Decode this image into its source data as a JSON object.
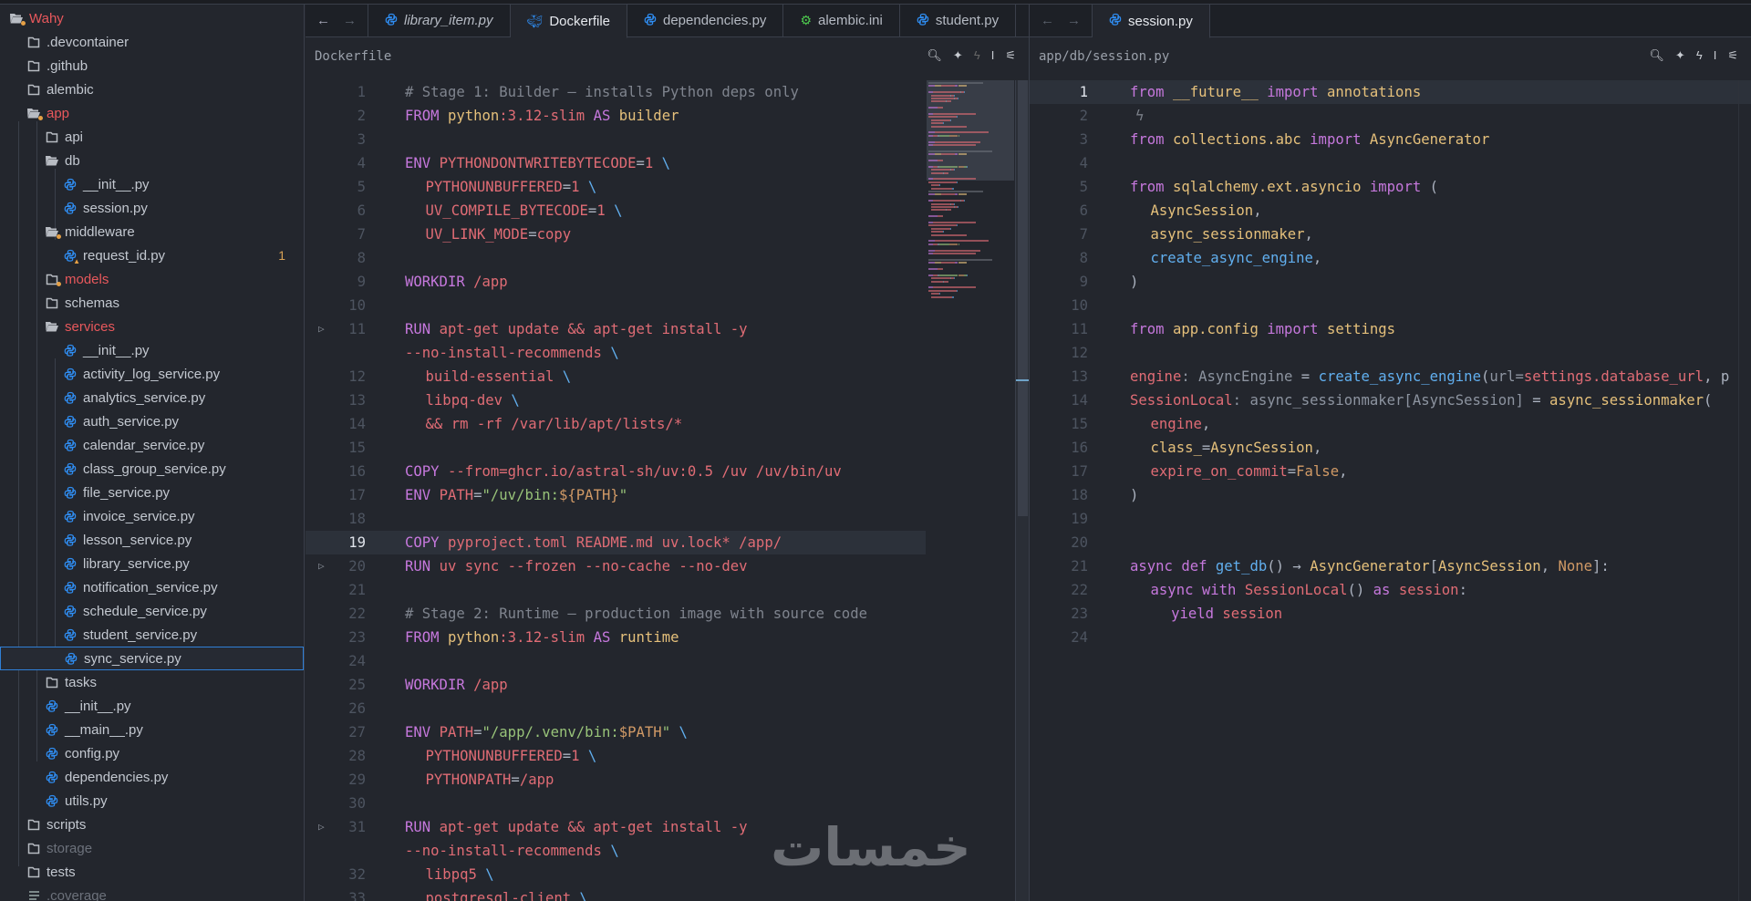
{
  "sidebar": {
    "items": [
      {
        "label": "Wahy",
        "level": 0,
        "icon": "folder-open-dot",
        "red": true
      },
      {
        "label": ".devcontainer",
        "level": 1,
        "icon": "folder"
      },
      {
        "label": ".github",
        "level": 1,
        "icon": "folder"
      },
      {
        "label": "alembic",
        "level": 1,
        "icon": "folder"
      },
      {
        "label": "app",
        "level": 1,
        "icon": "folder-open-dot",
        "red": true
      },
      {
        "label": "api",
        "level": 2,
        "icon": "folder"
      },
      {
        "label": "db",
        "level": 2,
        "icon": "folder-open"
      },
      {
        "label": "__init__.py",
        "level": 3,
        "icon": "python"
      },
      {
        "label": "session.py",
        "level": 3,
        "icon": "python"
      },
      {
        "label": "middleware",
        "level": 2,
        "icon": "folder-open-dot"
      },
      {
        "label": "request_id.py",
        "level": 3,
        "icon": "python-warning",
        "badge": "1"
      },
      {
        "label": "models",
        "level": 2,
        "icon": "folder-dot",
        "red": true
      },
      {
        "label": "schemas",
        "level": 2,
        "icon": "folder"
      },
      {
        "label": "services",
        "level": 2,
        "icon": "folder-open",
        "red": true
      },
      {
        "label": "__init__.py",
        "level": 3,
        "icon": "python"
      },
      {
        "label": "activity_log_service.py",
        "level": 3,
        "icon": "python"
      },
      {
        "label": "analytics_service.py",
        "level": 3,
        "icon": "python"
      },
      {
        "label": "auth_service.py",
        "level": 3,
        "icon": "python"
      },
      {
        "label": "calendar_service.py",
        "level": 3,
        "icon": "python"
      },
      {
        "label": "class_group_service.py",
        "level": 3,
        "icon": "python"
      },
      {
        "label": "file_service.py",
        "level": 3,
        "icon": "python"
      },
      {
        "label": "invoice_service.py",
        "level": 3,
        "icon": "python"
      },
      {
        "label": "lesson_service.py",
        "level": 3,
        "icon": "python"
      },
      {
        "label": "library_service.py",
        "level": 3,
        "icon": "python"
      },
      {
        "label": "notification_service.py",
        "level": 3,
        "icon": "python"
      },
      {
        "label": "schedule_service.py",
        "level": 3,
        "icon": "python"
      },
      {
        "label": "student_service.py",
        "level": 3,
        "icon": "python"
      },
      {
        "label": "sync_service.py",
        "level": 3,
        "icon": "python",
        "selected": true
      },
      {
        "label": "tasks",
        "level": 2,
        "icon": "folder"
      },
      {
        "label": "__init__.py",
        "level": 2,
        "icon": "python"
      },
      {
        "label": "__main__.py",
        "level": 2,
        "icon": "python"
      },
      {
        "label": "config.py",
        "level": 2,
        "icon": "python"
      },
      {
        "label": "dependencies.py",
        "level": 2,
        "icon": "python"
      },
      {
        "label": "utils.py",
        "level": 2,
        "icon": "python"
      },
      {
        "label": "scripts",
        "level": 1,
        "icon": "folder"
      },
      {
        "label": "storage",
        "level": 1,
        "icon": "folder",
        "dim": true
      },
      {
        "label": "tests",
        "level": 1,
        "icon": "folder"
      },
      {
        "label": ".coverage",
        "level": 1,
        "icon": "lines",
        "dim": true
      }
    ]
  },
  "colors": {
    "python": "#2f8cf0",
    "docker": "#2f8cf0",
    "ini": "#4ec94e",
    "accent": "#2f7fd6",
    "warning": "#e5a045"
  },
  "editors": [
    {
      "tabs": [
        {
          "label": "library_item.py",
          "icon": "python",
          "italic": true
        },
        {
          "label": "Dockerfile",
          "icon": "docker",
          "active": true
        },
        {
          "label": "dependencies.py",
          "icon": "python"
        },
        {
          "label": "alembic.ini",
          "icon": "gear"
        },
        {
          "label": "student.py",
          "icon": "python"
        }
      ],
      "breadcrumb": "Dockerfile",
      "current_line": 19,
      "lines": [
        {
          "n": "1",
          "t": [
            [
              "# Stage 1: Builder — installs Python deps only",
              "c"
            ]
          ]
        },
        {
          "n": "2",
          "t": [
            [
              "FROM ",
              "k"
            ],
            [
              "python",
              "y"
            ],
            [
              ":3.12-slim ",
              "r"
            ],
            [
              "AS ",
              "k"
            ],
            [
              "builder",
              "y"
            ]
          ]
        },
        {
          "n": "3",
          "t": []
        },
        {
          "n": "4",
          "t": [
            [
              "ENV ",
              "k"
            ],
            [
              "PYTHONDONTWRITEBYTECODE",
              "r"
            ],
            [
              "=",
              "w"
            ],
            [
              "1 ",
              "r"
            ],
            [
              "\\",
              "b"
            ]
          ]
        },
        {
          "n": "5",
          "i": 1,
          "t": [
            [
              "PYTHONUNBUFFERED",
              "r"
            ],
            [
              "=",
              "w"
            ],
            [
              "1 ",
              "r"
            ],
            [
              "\\",
              "b"
            ]
          ]
        },
        {
          "n": "6",
          "i": 1,
          "t": [
            [
              "UV_COMPILE_BYTECODE",
              "r"
            ],
            [
              "=",
              "w"
            ],
            [
              "1 ",
              "r"
            ],
            [
              "\\",
              "b"
            ]
          ]
        },
        {
          "n": "7",
          "i": 1,
          "t": [
            [
              "UV_LINK_MODE",
              "r"
            ],
            [
              "=",
              "w"
            ],
            [
              "copy",
              "r"
            ]
          ]
        },
        {
          "n": "8",
          "t": []
        },
        {
          "n": "9",
          "t": [
            [
              "WORKDIR ",
              "k"
            ],
            [
              "/app",
              "r"
            ]
          ]
        },
        {
          "n": "10",
          "t": []
        },
        {
          "n": "11",
          "fold": true,
          "t": [
            [
              "RUN ",
              "k"
            ],
            [
              "apt-get update && apt-get install -y",
              "r"
            ]
          ]
        },
        {
          "n": "",
          "t": [
            [
              "--no-install-recommends ",
              "r"
            ],
            [
              "\\",
              "b"
            ]
          ]
        },
        {
          "n": "12",
          "i": 1,
          "t": [
            [
              "build-essential ",
              "r"
            ],
            [
              "\\",
              "b"
            ]
          ]
        },
        {
          "n": "13",
          "i": 1,
          "t": [
            [
              "libpq-dev ",
              "r"
            ],
            [
              "\\",
              "b"
            ]
          ]
        },
        {
          "n": "14",
          "i": 1,
          "t": [
            [
              "&& rm -rf /var/lib/apt/lists/*",
              "r"
            ]
          ]
        },
        {
          "n": "15",
          "t": []
        },
        {
          "n": "16",
          "t": [
            [
              "COPY ",
              "k"
            ],
            [
              "--from=ghcr.io/astral-sh/uv:0.5 /uv /uv/bin/uv",
              "r"
            ]
          ]
        },
        {
          "n": "17",
          "t": [
            [
              "ENV ",
              "k"
            ],
            [
              "PATH",
              "r"
            ],
            [
              "=",
              "w"
            ],
            [
              "\"/uv/bin:",
              "g"
            ],
            [
              "${PATH}",
              "o"
            ],
            [
              "\"",
              "g"
            ]
          ]
        },
        {
          "n": "18",
          "t": []
        },
        {
          "n": "19",
          "t": [
            [
              "COPY ",
              "k"
            ],
            [
              "pyproject.toml README.md uv.lock* /app/",
              "r"
            ]
          ]
        },
        {
          "n": "20",
          "fold": true,
          "t": [
            [
              "RUN ",
              "k"
            ],
            [
              "uv sync --frozen --no-cache --no-dev",
              "r"
            ]
          ]
        },
        {
          "n": "21",
          "t": []
        },
        {
          "n": "22",
          "t": [
            [
              "# Stage 2: Runtime — production image with source code",
              "c"
            ]
          ]
        },
        {
          "n": "23",
          "t": [
            [
              "FROM ",
              "k"
            ],
            [
              "python",
              "y"
            ],
            [
              ":3.12-slim ",
              "r"
            ],
            [
              "AS ",
              "k"
            ],
            [
              "runtime",
              "y"
            ]
          ]
        },
        {
          "n": "24",
          "t": []
        },
        {
          "n": "25",
          "t": [
            [
              "WORKDIR ",
              "k"
            ],
            [
              "/app",
              "r"
            ]
          ]
        },
        {
          "n": "26",
          "t": []
        },
        {
          "n": "27",
          "t": [
            [
              "ENV ",
              "k"
            ],
            [
              "PATH",
              "r"
            ],
            [
              "=",
              "w"
            ],
            [
              "\"/app/.venv/bin:",
              "g"
            ],
            [
              "$PATH",
              "o"
            ],
            [
              "\" ",
              "g"
            ],
            [
              "\\",
              "b"
            ]
          ]
        },
        {
          "n": "28",
          "i": 1,
          "t": [
            [
              "PYTHONUNBUFFERED",
              "r"
            ],
            [
              "=",
              "w"
            ],
            [
              "1 ",
              "r"
            ],
            [
              "\\",
              "b"
            ]
          ]
        },
        {
          "n": "29",
          "i": 1,
          "t": [
            [
              "PYTHONPATH",
              "r"
            ],
            [
              "=",
              "w"
            ],
            [
              "/app",
              "r"
            ]
          ]
        },
        {
          "n": "30",
          "t": []
        },
        {
          "n": "31",
          "fold": true,
          "t": [
            [
              "RUN ",
              "k"
            ],
            [
              "apt-get update && apt-get install -y",
              "r"
            ]
          ]
        },
        {
          "n": "",
          "t": [
            [
              "--no-install-recommends ",
              "r"
            ],
            [
              "\\",
              "b"
            ]
          ]
        },
        {
          "n": "32",
          "i": 1,
          "t": [
            [
              "libpq5 ",
              "r"
            ],
            [
              "\\",
              "b"
            ]
          ]
        },
        {
          "n": "33",
          "i": 1,
          "t": [
            [
              "postgresql-client ",
              "r"
            ],
            [
              "\\",
              "b"
            ]
          ]
        }
      ]
    },
    {
      "tabs": [
        {
          "label": "session.py",
          "icon": "python",
          "active": true
        }
      ],
      "breadcrumb": "app/db/session.py",
      "current_line": 1,
      "lines": [
        {
          "n": "1",
          "t": [
            [
              "from ",
              "k"
            ],
            [
              "__future__ ",
              "y"
            ],
            [
              "import ",
              "k"
            ],
            [
              "annotations",
              "y"
            ]
          ]
        },
        {
          "n": "2",
          "bolt": true,
          "t": []
        },
        {
          "n": "3",
          "t": [
            [
              "from ",
              "k"
            ],
            [
              "collections.abc ",
              "y"
            ],
            [
              "import ",
              "k"
            ],
            [
              "AsyncGenerator",
              "y"
            ]
          ]
        },
        {
          "n": "4",
          "t": []
        },
        {
          "n": "5",
          "t": [
            [
              "from ",
              "k"
            ],
            [
              "sqlalchemy.ext.asyncio ",
              "y"
            ],
            [
              "import ",
              "k"
            ],
            [
              "(",
              "w"
            ]
          ]
        },
        {
          "n": "6",
          "i": 1,
          "t": [
            [
              "AsyncSession",
              "y"
            ],
            [
              ",",
              "w"
            ]
          ]
        },
        {
          "n": "7",
          "i": 1,
          "t": [
            [
              "async_sessionmaker",
              "y"
            ],
            [
              ",",
              "w"
            ]
          ]
        },
        {
          "n": "8",
          "i": 1,
          "t": [
            [
              "create_async_engine",
              "b"
            ],
            [
              ",",
              "w"
            ]
          ]
        },
        {
          "n": "9",
          "t": [
            [
              ")",
              "w"
            ]
          ]
        },
        {
          "n": "10",
          "t": []
        },
        {
          "n": "11",
          "t": [
            [
              "from ",
              "k"
            ],
            [
              "app.config ",
              "y"
            ],
            [
              "import ",
              "k"
            ],
            [
              "settings",
              "y"
            ]
          ]
        },
        {
          "n": "12",
          "t": []
        },
        {
          "n": "13",
          "t": [
            [
              "engine",
              "r"
            ],
            [
              ": AsyncEngine",
              "d"
            ],
            [
              " = ",
              "w"
            ],
            [
              "create_async_engine",
              "b"
            ],
            [
              "(",
              "w"
            ],
            [
              "url=",
              "d"
            ],
            [
              "settings.database_url",
              "r"
            ],
            [
              ", p",
              "w"
            ]
          ]
        },
        {
          "n": "14",
          "t": [
            [
              "SessionLocal",
              "r"
            ],
            [
              ": async_sessionmaker[AsyncSession]",
              "d"
            ],
            [
              " = ",
              "w"
            ],
            [
              "async_sessionmaker",
              "y"
            ],
            [
              "(",
              "w"
            ]
          ]
        },
        {
          "n": "15",
          "i": 1,
          "t": [
            [
              "engine",
              "r"
            ],
            [
              ",",
              "w"
            ]
          ]
        },
        {
          "n": "16",
          "i": 1,
          "t": [
            [
              "class_",
              "y"
            ],
            [
              "=",
              "w"
            ],
            [
              "AsyncSession",
              "y"
            ],
            [
              ",",
              "w"
            ]
          ]
        },
        {
          "n": "17",
          "i": 1,
          "t": [
            [
              "expire_on_commit",
              "r"
            ],
            [
              "=",
              "w"
            ],
            [
              "False",
              "o"
            ],
            [
              ",",
              "w"
            ]
          ]
        },
        {
          "n": "18",
          "t": [
            [
              ")",
              "w"
            ]
          ]
        },
        {
          "n": "19",
          "t": []
        },
        {
          "n": "20",
          "t": []
        },
        {
          "n": "21",
          "t": [
            [
              "async ",
              "k"
            ],
            [
              "def ",
              "k"
            ],
            [
              "get_db",
              "b"
            ],
            [
              "() → ",
              "w"
            ],
            [
              "AsyncGenerator",
              "y"
            ],
            [
              "[",
              "w"
            ],
            [
              "AsyncSession",
              "y"
            ],
            [
              ", ",
              "w"
            ],
            [
              "None",
              "o"
            ],
            [
              "]:",
              "w"
            ]
          ]
        },
        {
          "n": "22",
          "i": 1,
          "t": [
            [
              "async ",
              "k"
            ],
            [
              "with ",
              "k"
            ],
            [
              "SessionLocal",
              "r"
            ],
            [
              "() ",
              "w"
            ],
            [
              "as ",
              "k"
            ],
            [
              "session",
              "r"
            ],
            [
              ":",
              "w"
            ]
          ]
        },
        {
          "n": "23",
          "i": 2,
          "t": [
            [
              "yield ",
              "k"
            ],
            [
              "session",
              "r"
            ]
          ]
        },
        {
          "n": "24",
          "t": []
        }
      ]
    }
  ],
  "toolbar": {
    "nav_back": "←",
    "nav_forward": "→"
  },
  "watermark": "خمسات"
}
